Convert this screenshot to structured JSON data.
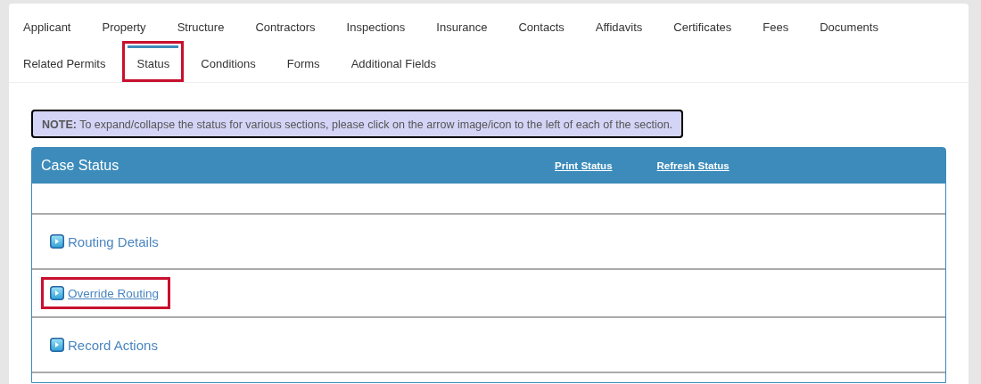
{
  "tabs": [
    [
      {
        "label": "Applicant",
        "selected": false,
        "highlighted": false
      },
      {
        "label": "Property",
        "selected": false,
        "highlighted": false
      },
      {
        "label": "Structure",
        "selected": false,
        "highlighted": false
      },
      {
        "label": "Contractors",
        "selected": false,
        "highlighted": false
      },
      {
        "label": "Inspections",
        "selected": false,
        "highlighted": false
      },
      {
        "label": "Insurance",
        "selected": false,
        "highlighted": false
      },
      {
        "label": "Contacts",
        "selected": false,
        "highlighted": false
      },
      {
        "label": "Affidavits",
        "selected": false,
        "highlighted": false
      },
      {
        "label": "Certificates",
        "selected": false,
        "highlighted": false
      },
      {
        "label": "Fees",
        "selected": false,
        "highlighted": false
      },
      {
        "label": "Documents",
        "selected": false,
        "highlighted": false
      }
    ],
    [
      {
        "label": "Related Permits",
        "selected": false,
        "highlighted": false
      },
      {
        "label": "Status",
        "selected": true,
        "highlighted": true
      },
      {
        "label": "Conditions",
        "selected": false,
        "highlighted": false
      },
      {
        "label": "Forms",
        "selected": false,
        "highlighted": false
      },
      {
        "label": "Additional Fields",
        "selected": false,
        "highlighted": false
      }
    ]
  ],
  "note": {
    "label": "NOTE:",
    "text": "To expand/collapse the status for various sections, please click on the arrow image/icon to the left of each of the section."
  },
  "panel": {
    "title": "Case Status",
    "links": [
      "Print Status",
      "Refresh Status"
    ],
    "sections": [
      {
        "label": "Routing Details",
        "kind": "heading",
        "highlighted": false
      },
      {
        "label": "Override Routing",
        "kind": "link",
        "highlighted": true
      },
      {
        "label": "Record Actions",
        "kind": "heading",
        "highlighted": false
      }
    ]
  }
}
